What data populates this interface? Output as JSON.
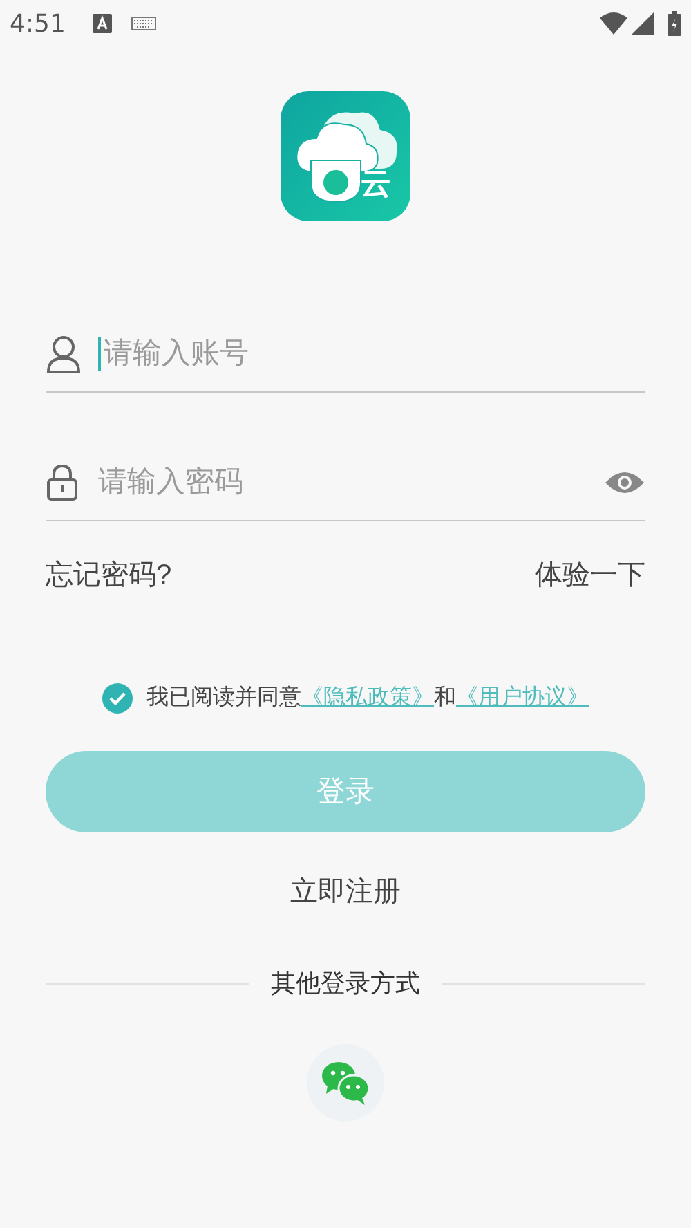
{
  "status_bar": {
    "time": "4:51"
  },
  "logo": {
    "text": "云"
  },
  "account_field": {
    "placeholder": "请输入账号",
    "focused": true
  },
  "password_field": {
    "placeholder": "请输入密码"
  },
  "forgot_password": "忘记密码?",
  "try_it": "体验一下",
  "agreement": {
    "checked": true,
    "text": "我已阅读并同意",
    "privacy_link": "《隐私政策》",
    "and": "和",
    "terms_link": "《用户协议》"
  },
  "login_button": {
    "label": "登录",
    "disabled": true
  },
  "register_link": "立即注册",
  "other_login": {
    "title": "其他登录方式"
  }
}
